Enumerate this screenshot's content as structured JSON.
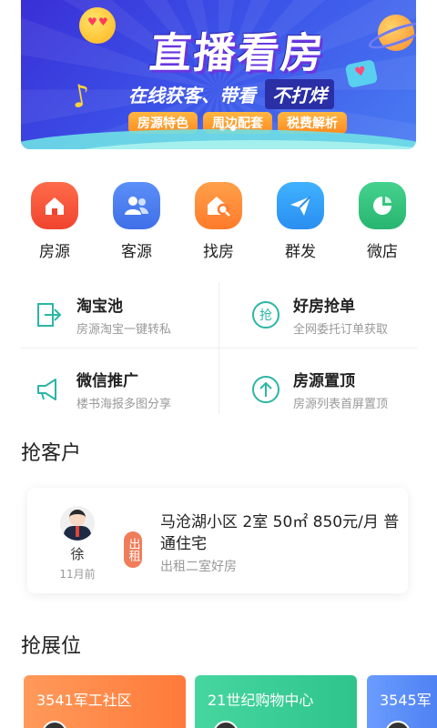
{
  "banner": {
    "headline": "直播看房",
    "subtitle_a": "在线获客、带看",
    "subtitle_b": "不打烊",
    "tags": [
      "房源特色",
      "周边配套",
      "税费解析"
    ]
  },
  "quick_actions": [
    {
      "label": "房源",
      "icon": "home-icon",
      "color": "#f5503a"
    },
    {
      "label": "客源",
      "icon": "people-icon",
      "color": "#4a7cf0"
    },
    {
      "label": "找房",
      "icon": "house-search-icon",
      "color": "#ff8a3a"
    },
    {
      "label": "群发",
      "icon": "send-icon",
      "color": "#2f9bf5"
    },
    {
      "label": "微店",
      "icon": "shop-icon",
      "color": "#31c27c"
    }
  ],
  "features": [
    {
      "title": "淘宝池",
      "desc": "房源淘宝一键转私",
      "icon": "export-icon"
    },
    {
      "title": "好房抢单",
      "desc": "全网委托订单获取",
      "icon": "grab-icon"
    },
    {
      "title": "微信推广",
      "desc": "楼书海报多图分享",
      "icon": "megaphone-icon"
    },
    {
      "title": "房源置顶",
      "desc": "房源列表首屏置顶",
      "icon": "arrow-up-icon"
    }
  ],
  "section_customers": "抢客户",
  "customer": {
    "name": "徐",
    "time": "11月前",
    "tag": "出租",
    "title": "马沧湖小区 2室 50㎡ 850元/月 普通住宅",
    "desc": "出租二室好房"
  },
  "section_booths": "抢展位",
  "booths": [
    {
      "name": "3541军工社区",
      "color": "#ff8a4a"
    },
    {
      "name": "21世纪购物中心",
      "color": "#3ccf9a"
    },
    {
      "name": "3545军",
      "color": "#5b8ff5"
    }
  ]
}
